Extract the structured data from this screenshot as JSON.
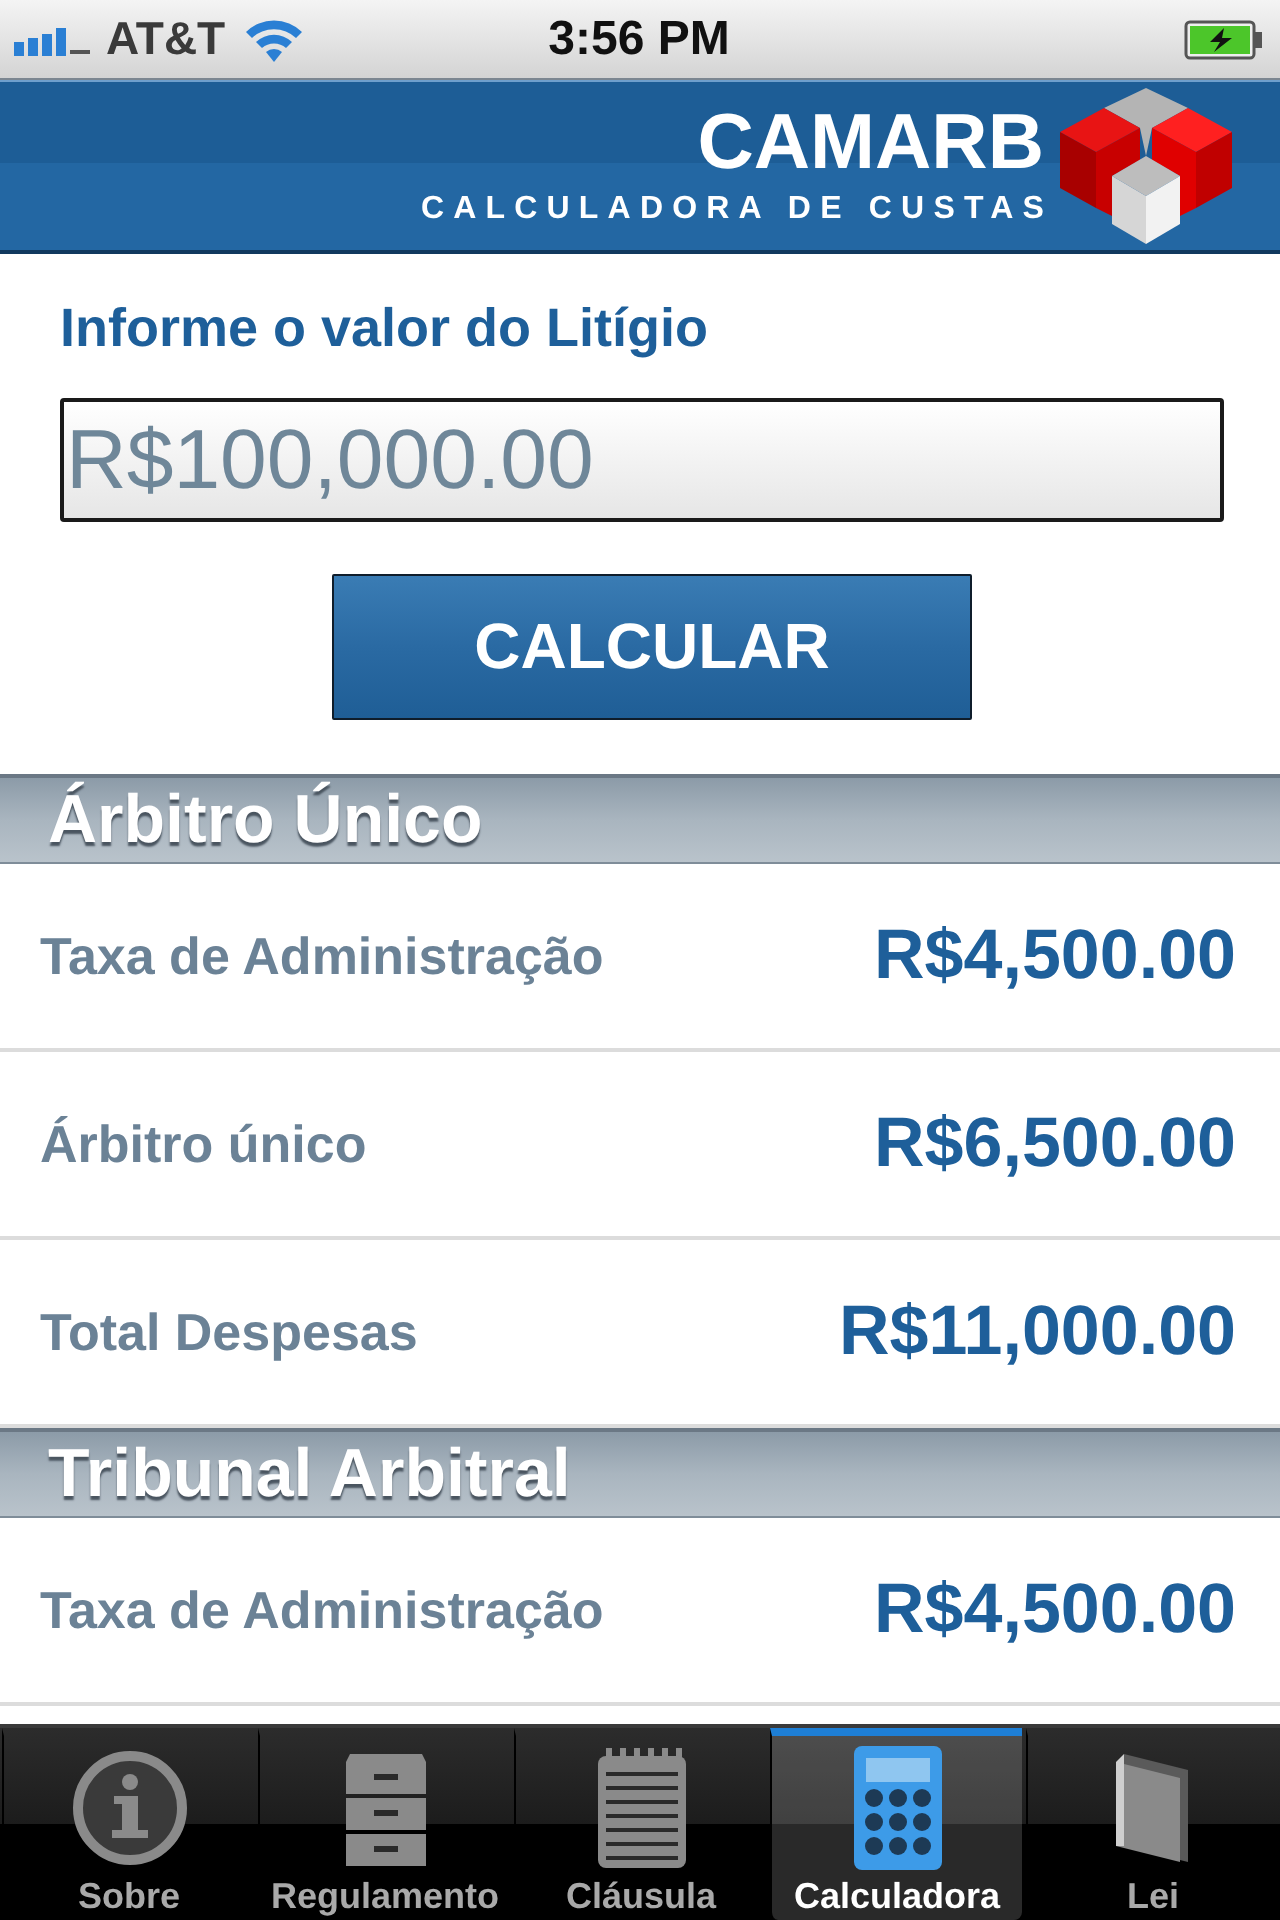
{
  "status_bar": {
    "carrier": "AT&T",
    "time": "3:56 PM"
  },
  "header": {
    "brand": "CAMARB",
    "subtitle": "CALCULADORA DE CUSTAS"
  },
  "form": {
    "label": "Informe o valor do Litígio",
    "value": "R$100,000.00",
    "button": "CALCULAR"
  },
  "sections": [
    {
      "title": "Árbitro Único",
      "rows": [
        {
          "label": "Taxa de Administração",
          "amount": "R$4,500.00"
        },
        {
          "label": "Árbitro único",
          "amount": "R$6,500.00"
        },
        {
          "label": "Total Despesas",
          "amount": "R$11,000.00"
        }
      ]
    },
    {
      "title": "Tribunal Arbitral",
      "rows": [
        {
          "label": "Taxa de Administração",
          "amount": "R$4,500.00"
        }
      ]
    }
  ],
  "tab_bar": [
    {
      "label": "Sobre",
      "selected": false
    },
    {
      "label": "Regulamento",
      "selected": false
    },
    {
      "label": "Cláusula",
      "selected": false
    },
    {
      "label": "Calculadora",
      "selected": true
    },
    {
      "label": "Lei",
      "selected": false
    }
  ]
}
